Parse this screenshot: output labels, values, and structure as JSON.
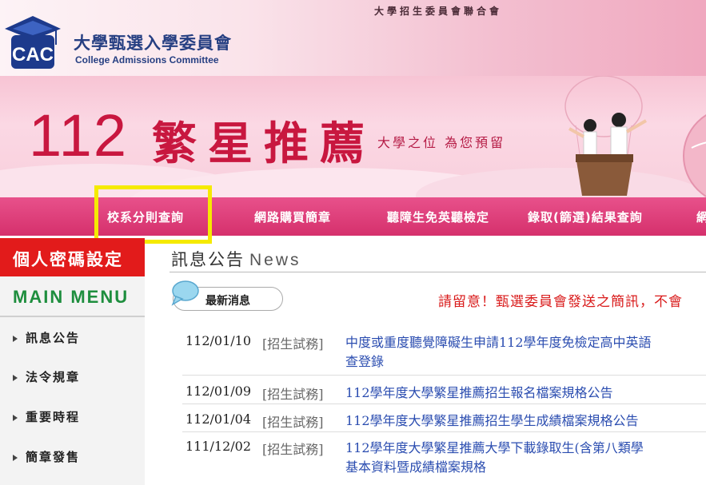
{
  "header": {
    "top_text": "大學招生委員會聯合會",
    "org_cn": "大學甄選入學委員會",
    "org_en": "College Admissions Committee",
    "logo_text": "CAC"
  },
  "banner": {
    "number": "112",
    "title": "繁星推薦",
    "slogan": "大學之位 為您預留"
  },
  "nav": {
    "items": [
      "校系分則查詢",
      "網路購買簡章",
      "聽障生免英聽檢定",
      "錄取(篩選)結果查詢",
      "網"
    ]
  },
  "sidebar": {
    "password_label": "個人密碼設定",
    "main_menu_label": "MAIN MENU",
    "items": [
      "訊息公告",
      "法令規章",
      "重要時程",
      "簡章發售"
    ]
  },
  "news": {
    "heading_cn": "訊息公告",
    "heading_en": "News",
    "latest_label": "最新消息",
    "notice": "請留意！甄選委員會發送之簡訊，不會",
    "rows": [
      {
        "date": "112/01/10",
        "category": "[招生試務]",
        "title_1": "中度或重度聽覺障礙生申請112學年度免檢定高中英語",
        "title_2": "查登錄"
      },
      {
        "date": "112/01/09",
        "category": "[招生試務]",
        "title_1": "112學年度大學繁星推薦招生報名檔案規格公告",
        "title_2": ""
      },
      {
        "date": "112/01/04",
        "category": "[招生試務]",
        "title_1": "112學年度大學繁星推薦招生學生成績檔案規格公告",
        "title_2": ""
      },
      {
        "date": "111/12/02",
        "category": "[招生試務]",
        "title_1": "112學年度大學繁星推薦大學下載錄取生(含第八類學",
        "title_2": "基本資料暨成績檔案規格"
      }
    ]
  },
  "colors": {
    "accent_pink": "#d5306c",
    "banner_red": "#c8173f",
    "sidebar_red": "#e21b1b",
    "menu_green": "#1e8e3e",
    "link_blue": "#2b4db0",
    "highlight_yellow": "#f5ea00"
  }
}
